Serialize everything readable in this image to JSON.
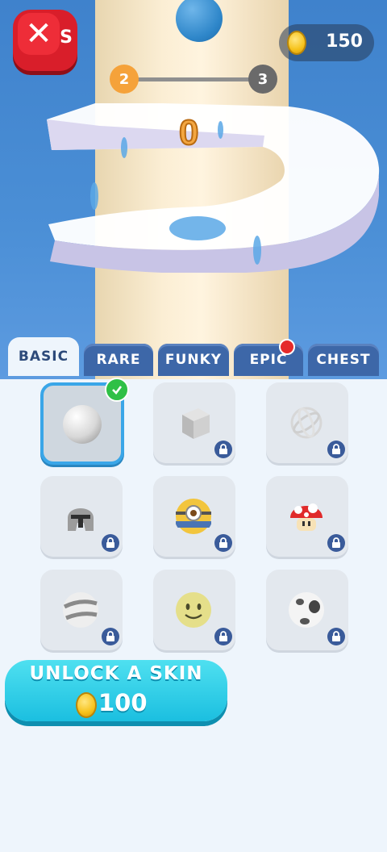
{
  "header": {
    "close_label": "✕",
    "close_peek_text": "S",
    "coins": "150",
    "progress": {
      "current_level": "2",
      "next_level": "3"
    },
    "score": "0"
  },
  "tabs": [
    {
      "label": "BASIC",
      "active": true
    },
    {
      "label": "RARE"
    },
    {
      "label": "FUNKY"
    },
    {
      "label": "EPIC",
      "notification": true
    },
    {
      "label": "CHEST"
    }
  ],
  "skins": [
    {
      "name": "white-ball",
      "selected": true,
      "locked": false
    },
    {
      "name": "cube",
      "locked": true
    },
    {
      "name": "gyroscope",
      "locked": true
    },
    {
      "name": "helmet",
      "locked": true
    },
    {
      "name": "minion-ball",
      "locked": true
    },
    {
      "name": "mushroom",
      "locked": true
    },
    {
      "name": "planet-ball",
      "locked": true
    },
    {
      "name": "smiley-ball",
      "locked": true
    },
    {
      "name": "soccer-ball",
      "locked": true
    }
  ],
  "unlock_button": {
    "title": "UNLOCK A SKIN",
    "price": "100"
  },
  "colors": {
    "accent": "#1bbfe0",
    "close": "#d91e2a",
    "tab": "#3d67a8",
    "lock": "#3a5b9a",
    "check": "#2fc046"
  }
}
